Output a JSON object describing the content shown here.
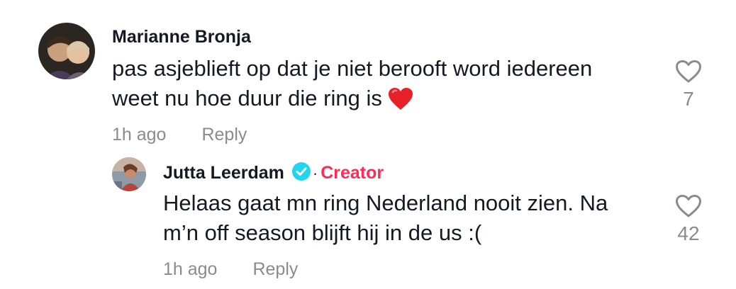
{
  "comments": [
    {
      "username": "Marianne Bronja",
      "text_line1": "pas asjeblieft op dat je niet berooft word iedereen",
      "text_line2": "weet nu hoe duur die ring is",
      "text_emoji": "red-heart-emoji",
      "time": "1h ago",
      "reply_label": "Reply",
      "likes": "7"
    },
    {
      "username": "Jutta Leerdam",
      "badge": "verified-icon",
      "separator": "·",
      "creator_label": "Creator",
      "text_line1": "Helaas gaat mn ring Nederland nooit zien. Na",
      "text_line2": "m’n off season blijft hij in de us :(",
      "time": "1h ago",
      "reply_label": "Reply",
      "likes": "42"
    }
  ],
  "colors": {
    "text": "#161823",
    "muted": "#8a8b91",
    "creator": "#fe2c55",
    "verified": "#20d5ec"
  }
}
